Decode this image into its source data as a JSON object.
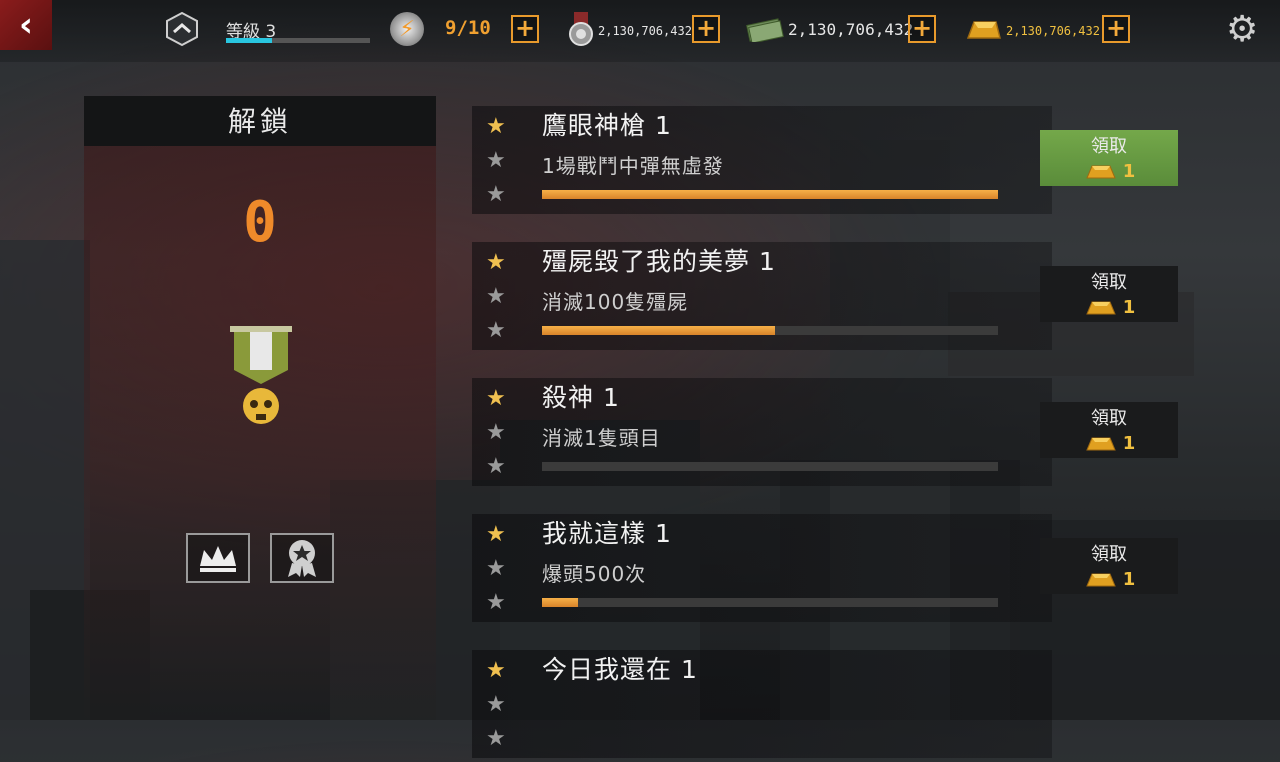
{
  "header": {
    "level_label": "等級 3",
    "level_progress": 0.32,
    "energy": "9/10",
    "medals": "2,130,706,432",
    "cash": "2,130,706,432",
    "gold": "2,130,706,432"
  },
  "panel": {
    "title": "解鎖",
    "count": "0"
  },
  "achievements": [
    {
      "title": "鷹眼神槍 1",
      "desc": "1場戰鬥中彈無虛發",
      "stars": 1,
      "progress": 1.0,
      "claim_label": "領取",
      "reward": "1",
      "claimable": true
    },
    {
      "title": "殭屍毀了我的美夢 1",
      "desc": "消滅100隻殭屍",
      "stars": 1,
      "progress": 0.51,
      "claim_label": "領取",
      "reward": "1",
      "claimable": false
    },
    {
      "title": "殺神 1",
      "desc": "消滅1隻頭目",
      "stars": 1,
      "progress": 0.0,
      "claim_label": "領取",
      "reward": "1",
      "claimable": false
    },
    {
      "title": "我就這樣 1",
      "desc": "爆頭500次",
      "stars": 1,
      "progress": 0.08,
      "claim_label": "領取",
      "reward": "1",
      "claimable": false
    },
    {
      "title": "今日我還在 1",
      "desc": "",
      "stars": 1,
      "progress": 0.0,
      "claim_label": "",
      "reward": "",
      "claimable": false
    }
  ],
  "colors": {
    "accent": "#ef8a2a",
    "gold": "#f0c040",
    "claim_active": "#6a9c44"
  }
}
